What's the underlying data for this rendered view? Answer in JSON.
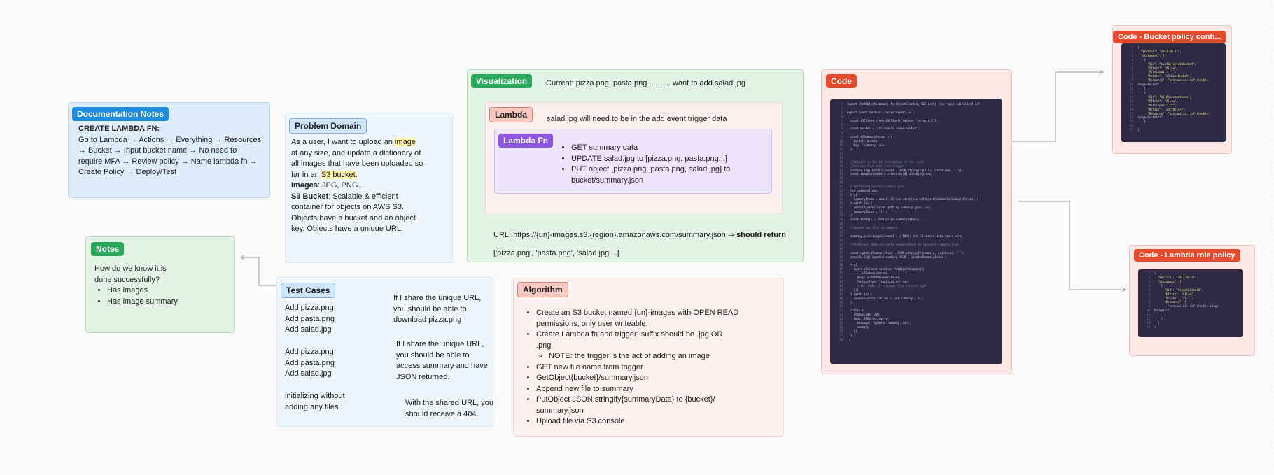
{
  "doc_notes": {
    "tag": "Documentation Notes",
    "heading": "CREATE LAMBDA FN:",
    "body": "Go to Lambda → Actions → Everything → Resources → Bucket → Input bucket name → No need to require MFA → Review policy → Name lambda fn → Create Policy → Deploy/Test"
  },
  "problem_domain": {
    "tag": "Problem Domain",
    "p1_a": "As a user, I want to upload an ",
    "p1_hl1": "image",
    "p1_b": " at any size, and update a dictionary of all images that have been uploaded so far in an ",
    "p1_hl2": "S3 bucket",
    "p1_c": ".",
    "images_label": "Images",
    "images_text": ": JPG, PNG...",
    "s3_label": "S3 Bucket",
    "s3_text": ": Scalable & efficient container for objects on AWS S3. Objects have a bucket and an object key. Objects have a unique URL."
  },
  "notes": {
    "tag": "Notes",
    "question_1": "How do we know it is",
    "question_2": "done successfully?",
    "items": [
      "Has images",
      "Has image summary"
    ]
  },
  "test_cases": {
    "tag": "Test Cases",
    "group1": [
      "Add pizza.png",
      "Add pasta.png",
      "Add salad.jpg"
    ],
    "group1_result": "If I share the unique URL, you should be able to download pizza.png",
    "group2": [
      "Add pizza.png",
      "Add pasta.png",
      "Add salad.jpg"
    ],
    "group2_result": "If I share the unique URL, you should be able to access summary and have JSON returned.",
    "group3_1": "initializing without",
    "group3_2": "adding any files",
    "group3_result": "With the shared URL, you should receive a 404."
  },
  "visualization": {
    "tag": "Visualization",
    "current": "Current: pizza.png, pasta.png .......... want to add salad.jpg",
    "lambda_tag": "Lambda",
    "lambda_note": "salad.jpg will need to be in the add event trigger data",
    "lambda_fn_tag": "Lambda Fn",
    "lambda_fn_items": [
      "GET summary data",
      "UPDATE salad.jpg to [pizza.png, pasta.png...]",
      "PUT object [pizza.png, pasta.png, salad.jpg] to bucket/summary.json"
    ],
    "url_text": "URL: https://{un}-images.s3.{region}.amazonaws.com/summary.json ⇒ ",
    "url_bold": "should return",
    "url_result": "['pizza.png', 'pasta.png', 'salad.jpg'...]"
  },
  "algorithm": {
    "tag": "Algorithm",
    "items": [
      "Create an S3 bucket named {un}-images with OPEN READ permissions, only user writeable.",
      "Create Lambda fn and trigger: suffix should be .jpg OR .png",
      "GET new file name from trigger",
      "GetObject{bucket}/summary.json",
      "Append new file to summary",
      "PutObject JSON.stringify{summaryData} to {bucket}/ summary.json",
      "Upload file via S3 console"
    ],
    "sub_item": "NOTE: the trigger is the act of adding an image"
  },
  "code": {
    "tag": "Code",
    "lines": [
      "import {GetObjectCommand, PutObjectCommand, S3Client} from '@aws-sdk/client-s3';",
      "",
      "export const handler = async(event) => {",
      "",
      "  const s3Client = new S3Client({region: 'us-west-2'});",
      "",
      "  const bucket = 'cf-rrenkis-image-bucket';",
      "",
      "  const s3SummaryParams = {",
      "    Bucket: bucket,",
      "    Key: 'summary.json'",
      "  };",
      "",
      "",
      "  //Details on the S3 information in the event",
      "  //Get new file name from trigger",
      "  console.log('handler event', JSON.stringify(file, undefined, ' '));",
      "  const imageUploaded = e.Records[0].s3.object.key;",
      "",
      "",
      "  //GetObject{bucket}/summary.json",
      "  let summaryItems;",
      "  try{",
      "    summaryItems = await s3Client.send(new GetObjectCommand(s3SummaryParams));",
      "  } catch (e) {",
      "    console.warn('Error getting summary.json', e);",
      "    summaryItems = '[]';",
      "  }",
      "  const summary = JSON.parse(summaryItems);",
      "",
      "  //Append new file to summary",
      "",
      "  summary.push(imageUploaded); //TODO: the s3 cached data needs work",
      "",
      "  //PutObject JSON.stringify{summaryData} to {bucket}/summary.json",
      "",
      "  const updatedSummaryItems = JSON.stringify(summary, undefined, ' ');",
      "  console.log('updated summary JSON', updatedSummaryItems);",
      "",
      "  try{",
      "    await s3Client.send(new PutObjectCommand({",
      "      ...s3SummaryParams,",
      "      Body: updatedSummaryItems,",
      "      ContentType: 'application/json'",
      "      //for JSON, it's always this content type",
      "    }));",
      "  } catch (e) {",
      "    console.warn('Failed to put summary', e);",
      "  }",
      "",
      "  return {",
      "    statusCode: 200,",
      "    body: JSON.stringify({",
      "      message: 'updated summary.json',",
      "      summary",
      "    })",
      "  };",
      "};"
    ]
  },
  "bucket_policy": {
    "tag": "Code - Bucket policy confi...",
    "lines": [
      "{",
      "  \"Version\": \"2012-10-17\",",
      "  \"Statement\": [",
      "    {",
      "      \"Sid\": \"ListObjectsInBucket\",",
      "      \"Effect\": \"Allow\",",
      "      \"Principal\": \"*\",",
      "      \"Action\": \"s3:ListBucket\",",
      "      \"Resource\": \"arn:aws:s3:::cf-rrenkis-",
      "image-bucket\"",
      "    },",
      "    {",
      "      \"Sid\": \"AllObjectActions\",",
      "      \"Effect\": \"Allow\",",
      "      \"Principal\": \"*\",",
      "      \"Action\": \"s3:*Object\",",
      "      \"Resource\": \"arn:aws:s3:::cf-rrenkis-",
      "image-bucket/*\"",
      "    }",
      "  ]",
      "}"
    ]
  },
  "lambda_role": {
    "tag": "Code - Lambda role policy",
    "lines": [
      "{",
      "  \"Version\": \"2012-10-17\",",
      "  \"Statement\": [",
      "    {",
      "      \"Sid\": \"VisualEditor0\",",
      "      \"Effect\": \"Allow\",",
      "      \"Action\": \"s3:*\",",
      "      \"Resource\": [",
      "        \"arn:aws:s3:::cf-rrenkis-image-",
      "bucket/*\"",
      "      ]",
      "    }",
      "  ]",
      "}"
    ]
  },
  "colors": {
    "blue_frame": "#deecfb",
    "blue_tag": "#1d8ce0",
    "green_frame": "#e2f2e4",
    "green_tag": "#27a85b",
    "red_frame": "#fde8e5",
    "red_tag": "#e64a2e",
    "purple_frame": "#ece5fb",
    "purple_tag": "#8e56e0",
    "code_bg": "#2f2a44"
  }
}
